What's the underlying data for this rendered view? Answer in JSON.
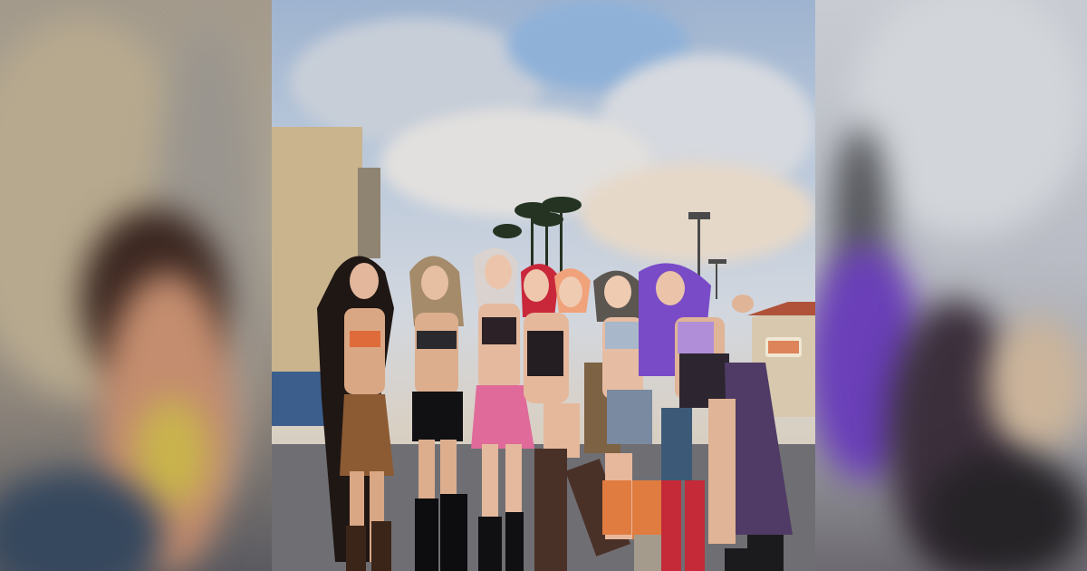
{
  "image": {
    "subject": "",
    "layout": "center-photo-with-blurred-sides"
  },
  "colors": {
    "sky_top": "#9eb3cf",
    "sky_bottom": "#d9d0c4",
    "building": "#c9b48e",
    "pavement": "#6f6f73",
    "hair_purple": "#7a4bc7",
    "hair_red": "#c9283a",
    "skirt_pink": "#e06a9a"
  },
  "scene": {
    "people_count": 7
  }
}
